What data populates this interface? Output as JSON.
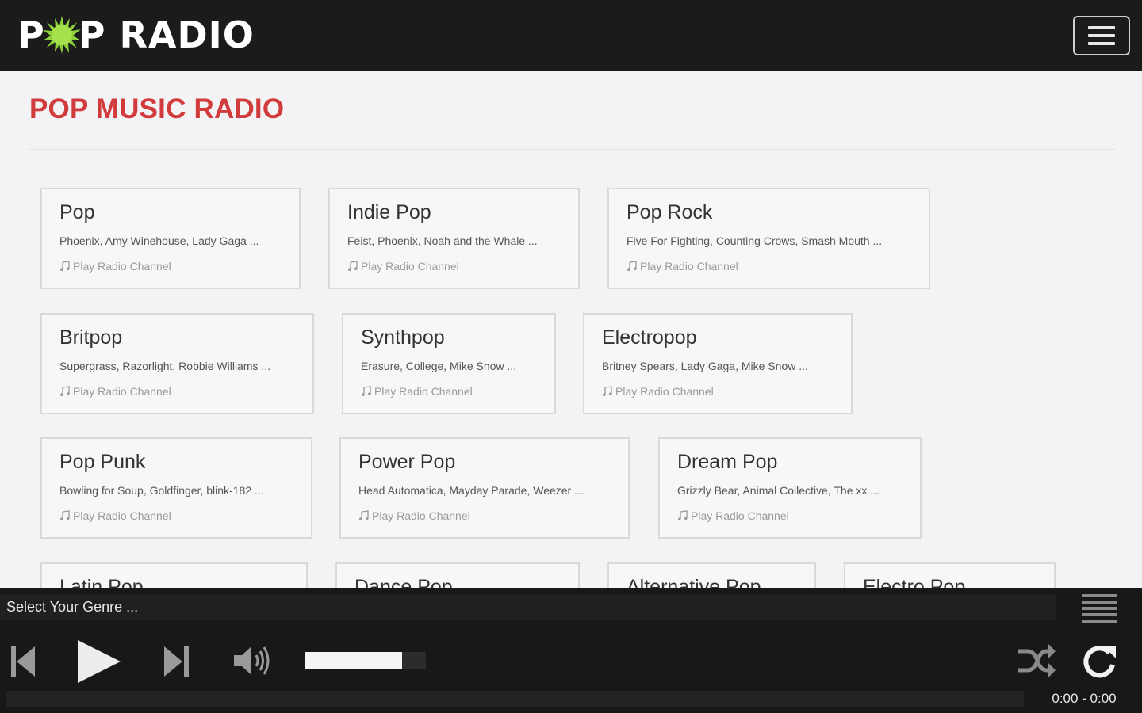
{
  "header": {
    "logo_letters_before": "P",
    "logo_letters_after": "P RADIO",
    "logo_accent_color": "#8dd13a",
    "menu_icon": "hamburger-icon"
  },
  "page": {
    "title": "POP MUSIC RADIO",
    "title_color": "#d13b3b"
  },
  "genres": [
    {
      "name": "Pop",
      "artists": "Phoenix, Amy Winehouse, Lady Gaga ...",
      "action": "Play Radio Channel"
    },
    {
      "name": "Indie Pop",
      "artists": "Feist, Phoenix, Noah and the Whale ...",
      "action": "Play Radio Channel"
    },
    {
      "name": "Pop Rock",
      "artists": "Five For Fighting, Counting Crows, Smash Mouth ...",
      "action": "Play Radio Channel"
    },
    {
      "name": "Britpop",
      "artists": "Supergrass, Razorlight, Robbie Williams ...",
      "action": "Play Radio Channel"
    },
    {
      "name": "Synthpop",
      "artists": "Erasure, College, Mike Snow ...",
      "action": "Play Radio Channel"
    },
    {
      "name": "Electropop",
      "artists": "Britney Spears, Lady Gaga, Mike Snow ...",
      "action": "Play Radio Channel"
    },
    {
      "name": "Pop Punk",
      "artists": "Bowling for Soup, Goldfinger, blink-182 ...",
      "action": "Play Radio Channel"
    },
    {
      "name": "Power Pop",
      "artists": "Head Automatica, Mayday Parade, Weezer ...",
      "action": "Play Radio Channel"
    },
    {
      "name": "Dream Pop",
      "artists": "Grizzly Bear, Animal Collective, The xx ...",
      "action": "Play Radio Channel"
    },
    {
      "name": "Latin Pop",
      "artists": "",
      "action": ""
    },
    {
      "name": "Dance Pop",
      "artists": "",
      "action": ""
    },
    {
      "name": "Alternative Pop",
      "artists": "",
      "action": ""
    },
    {
      "name": "Electro Pop",
      "artists": "",
      "action": ""
    }
  ],
  "player": {
    "genre_label": "Select Your Genre ...",
    "volume_percent": 80,
    "progress_percent": 0,
    "time_display": "0:00 - 0:00",
    "icons": [
      "previous-icon",
      "play-icon",
      "next-icon",
      "volume-icon",
      "shuffle-icon",
      "repeat-icon",
      "playlist-icon"
    ]
  }
}
